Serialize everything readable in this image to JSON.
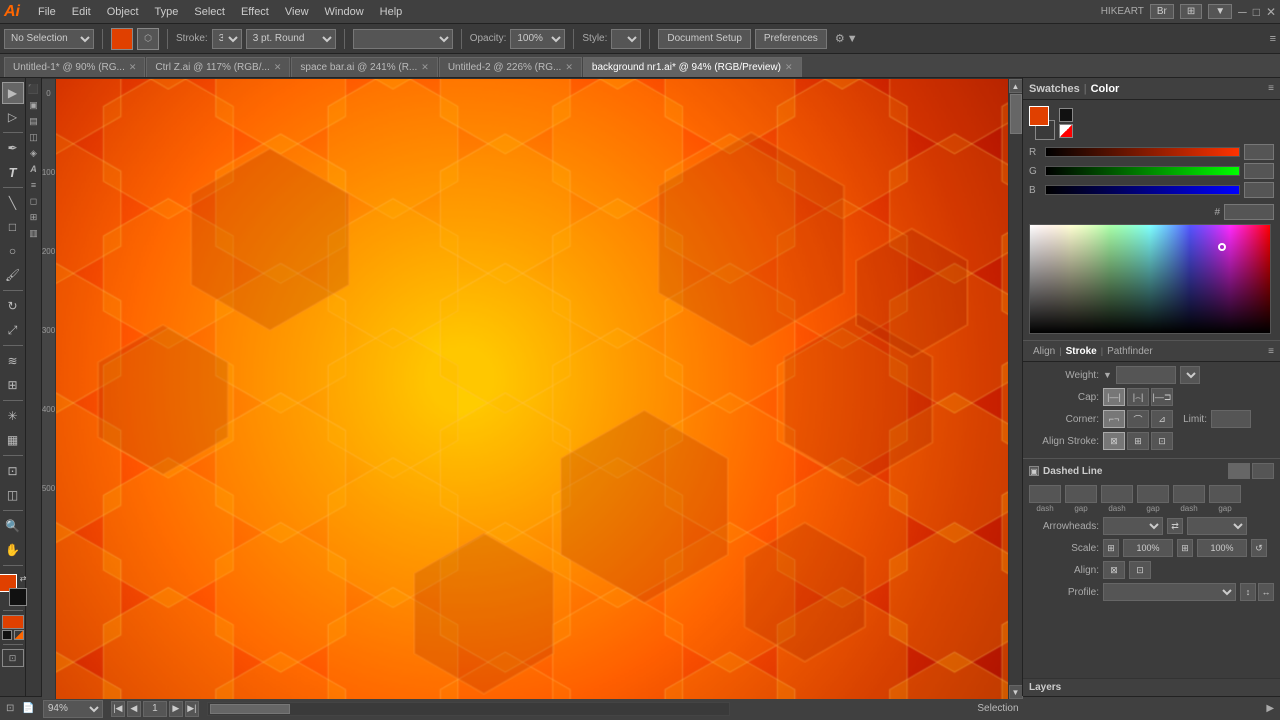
{
  "app": {
    "title": "HIKEART",
    "icon_label": "Ai"
  },
  "menubar": {
    "items": [
      "File",
      "Edit",
      "Object",
      "Type",
      "Select",
      "Effect",
      "View",
      "Window",
      "Help"
    ],
    "bridge_btn": "Br",
    "arrange_btn": "◫"
  },
  "toolbar": {
    "no_selection": "No Selection",
    "stroke_label": "Stroke:",
    "stroke_value": "3 pt. Round",
    "opacity_label": "Opacity:",
    "opacity_value": "100%",
    "style_label": "Style:",
    "doc_setup_btn": "Document Setup",
    "preferences_btn": "Preferences"
  },
  "tabs": [
    {
      "label": "Untitled-1* @ 90% (RG...",
      "active": false,
      "id": "tab1"
    },
    {
      "label": "Ctrl Z.ai @ 117% (RGB/...",
      "active": false,
      "id": "tab2"
    },
    {
      "label": "space bar.ai @ 241% (R...",
      "active": false,
      "id": "tab3"
    },
    {
      "label": "Untitled-2 @ 226% (RG...",
      "active": false,
      "id": "tab4"
    },
    {
      "label": "background nr1.ai* @ 94% (RGB/Preview)",
      "active": true,
      "id": "tab5"
    }
  ],
  "color_panel": {
    "swatches_label": "Swatches",
    "color_label": "Color",
    "r_label": "R",
    "g_label": "G",
    "b_label": "B",
    "hex_value": "",
    "hash_label": "#"
  },
  "stroke_panel": {
    "align_label": "Align",
    "stroke_label": "Stroke",
    "pathfinder_label": "Pathfinder",
    "weight_label": "Weight:",
    "cap_label": "Cap:",
    "corner_label": "Corner:",
    "limit_label": "Limit:",
    "align_stroke_label": "Align Stroke:"
  },
  "dashed_section": {
    "label": "Dashed Line",
    "dash_labels": [
      "dash",
      "gap",
      "dash",
      "gap",
      "dash",
      "gap"
    ],
    "arrowheads_label": "Arrowheads:",
    "scale_label": "Scale:",
    "scale1_value": "100%",
    "scale2_value": "100%",
    "align_label": "Align:",
    "profile_label": "Profile:"
  },
  "bottombar": {
    "zoom_value": "94%",
    "page_value": "1",
    "status_label": "Selection"
  },
  "layers_panel": {
    "label": "Layers"
  }
}
